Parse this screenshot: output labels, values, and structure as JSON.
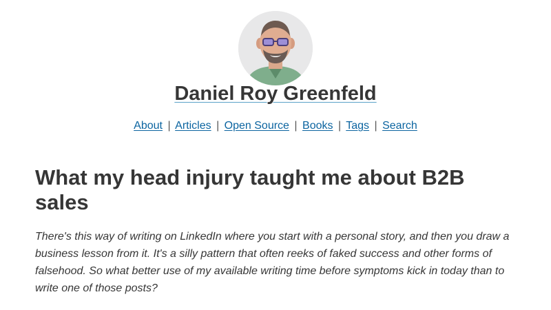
{
  "header": {
    "avatar_alt": "Daniel Roy Greenfeld avatar",
    "site_title": "Daniel Roy Greenfeld"
  },
  "nav": {
    "items": [
      {
        "label": "About"
      },
      {
        "label": "Articles"
      },
      {
        "label": "Open Source"
      },
      {
        "label": "Books"
      },
      {
        "label": "Tags"
      },
      {
        "label": "Search"
      }
    ],
    "separator": "|"
  },
  "article": {
    "title": "What my head injury taught me about B2B sales",
    "intro": "There's this way of writing on LinkedIn where you start with a personal story, and then you draw a business lesson from it. It's a silly pattern that often reeks of faked success and other forms of falsehood. So what better use of my available writing time before symptoms kick in today than to write one of those posts?"
  },
  "colors": {
    "link": "#0b64a0",
    "text": "#363636",
    "title_underline": "#5aa1c8"
  }
}
